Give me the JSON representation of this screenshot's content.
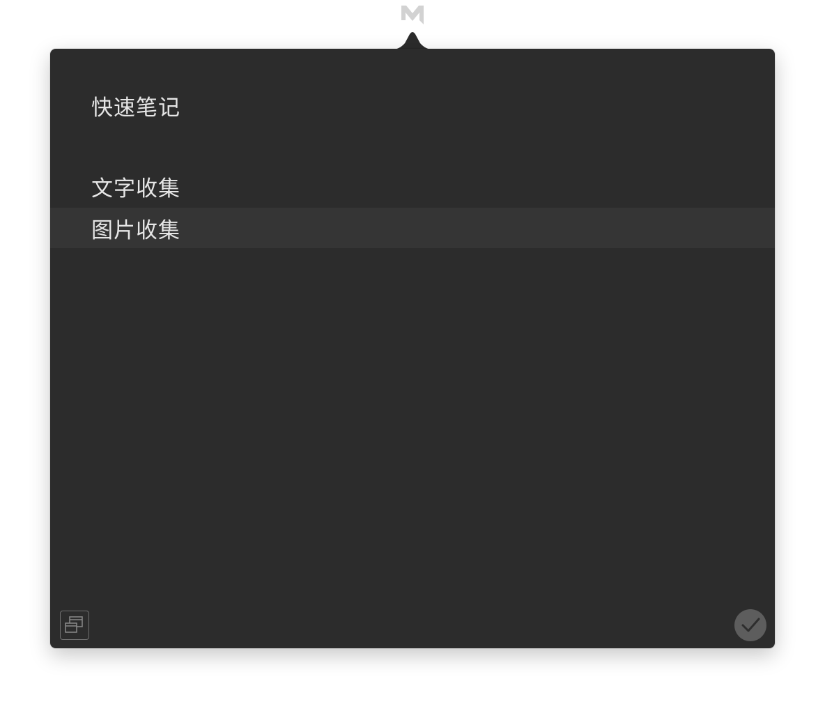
{
  "app": {
    "menubar_icon": "marginnote-m-icon"
  },
  "popover": {
    "menu_items": [
      {
        "label": "快速笔记",
        "highlighted": false
      },
      {
        "label": "文字收集",
        "highlighted": false
      },
      {
        "label": "图片收集",
        "highlighted": true
      }
    ],
    "footer": {
      "left_icon": "windows-stack-icon",
      "right_icon": "checkmark-icon"
    }
  },
  "colors": {
    "popover_bg": "#2c2c2c",
    "highlight_bg": "#353535",
    "text": "#e6e6e6",
    "confirm_bg": "#5d5d5d"
  }
}
